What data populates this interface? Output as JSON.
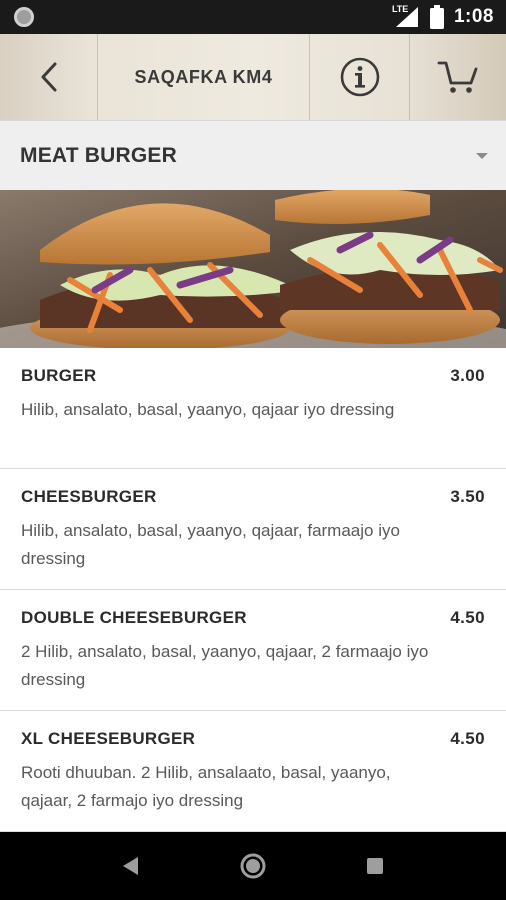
{
  "status_bar": {
    "network": "LTE",
    "time": "1:08"
  },
  "app_bar": {
    "title": "SAQAFKA KM4",
    "back_icon": "chevron-left-icon",
    "info_icon": "info-circle-icon",
    "cart_icon": "shopping-cart-icon"
  },
  "category": {
    "title": "MEAT BURGER",
    "dropdown_icon": "caret-down-icon"
  },
  "menu": {
    "items": [
      {
        "name": "BURGER",
        "price": "3.00",
        "description": "Hilib, ansalato, basal, yaanyo, qajaar iyo dressing"
      },
      {
        "name": "CHEESBURGER",
        "price": "3.50",
        "description": "Hilib, ansalato, basal, yaanyo, qajaar, farmaajo iyo dressing"
      },
      {
        "name": "DOUBLE CHEESEBURGER",
        "price": "4.50",
        "description": "2 Hilib, ansalato, basal, yaanyo, qajaar, 2 farmaajo iyo dressing"
      },
      {
        "name": "XL CHEESEBURGER",
        "price": "4.50",
        "description": "Rooti dhuuban. 2 Hilib, ansalaato, basal, yaanyo, qajaar, 2 farmajo iyo dressing"
      }
    ]
  },
  "nav_bar": {
    "back_icon": "nav-back-triangle-icon",
    "home_icon": "nav-home-circle-icon",
    "recents_icon": "nav-recents-square-icon"
  },
  "colors": {
    "status_bar": "#1a1a1a",
    "app_bar": "#efeadf",
    "category_bar": "#efefef",
    "text_primary": "#2b2b2b",
    "text_secondary": "#595959"
  }
}
